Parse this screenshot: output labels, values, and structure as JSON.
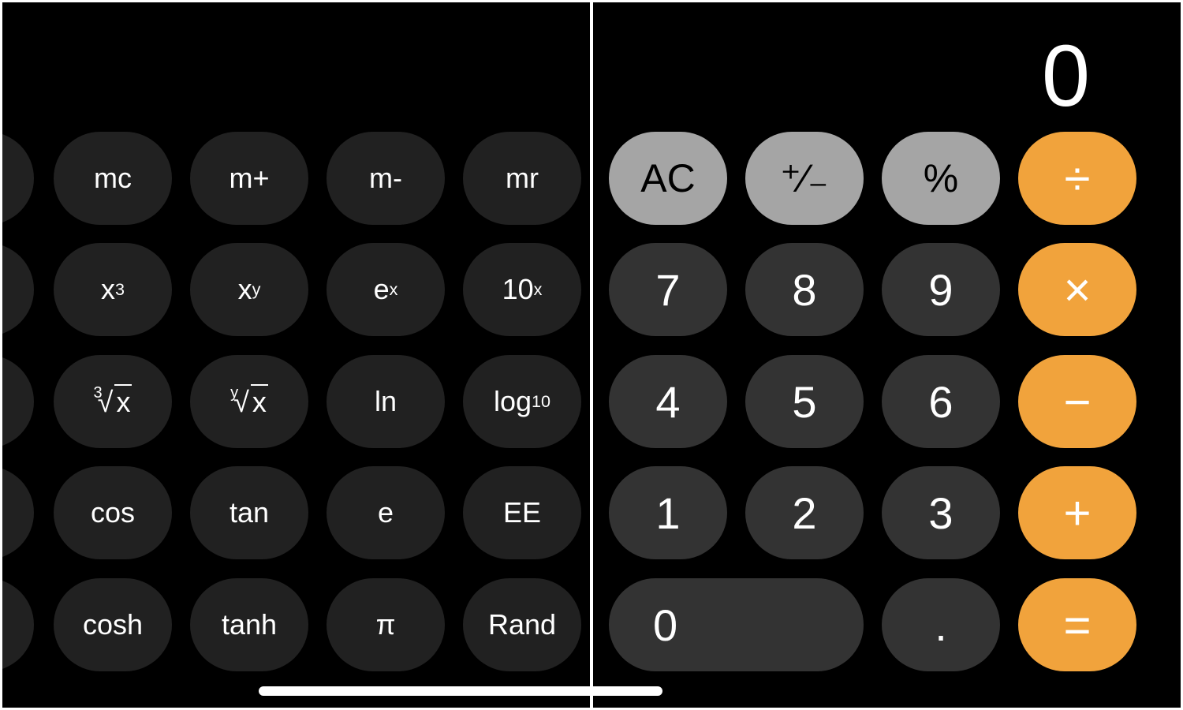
{
  "display": {
    "value": "0"
  },
  "scientific": {
    "rows": [
      [
        "mc",
        "m+",
        "m-",
        "mr"
      ],
      [
        "x3",
        "xy",
        "ex",
        "10x"
      ],
      [
        "cbrt",
        "yroot",
        "ln",
        "log10"
      ],
      [
        "cos",
        "tan",
        "e",
        "EE"
      ],
      [
        "cosh",
        "tanh",
        "π",
        "Rand"
      ]
    ],
    "labels": {
      "mc": "mc",
      "mplus": "m+",
      "mminus": "m-",
      "mr": "mr",
      "x": "x",
      "three": "3",
      "y": "y",
      "e": "e",
      "ten": "10",
      "log": "log",
      "ten_sub": "10",
      "ln": "ln",
      "cos": "cos",
      "tan": "tan",
      "e_const": "e",
      "EE": "EE",
      "cosh": "cosh",
      "tanh": "tanh",
      "pi": "π",
      "rand": "Rand"
    }
  },
  "keypad": {
    "ac": "AC",
    "sign": "⁺∕₋",
    "percent": "%",
    "divide": "÷",
    "seven": "7",
    "eight": "8",
    "nine": "9",
    "multiply": "×",
    "four": "4",
    "five": "5",
    "six": "6",
    "minus": "−",
    "one": "1",
    "two": "2",
    "three": "3",
    "plus": "+",
    "zero": "0",
    "decimal": ".",
    "equals": "="
  },
  "colors": {
    "operator": "#f1a33c",
    "function": "#a5a5a5",
    "digit": "#333333",
    "scientific": "#212121"
  }
}
